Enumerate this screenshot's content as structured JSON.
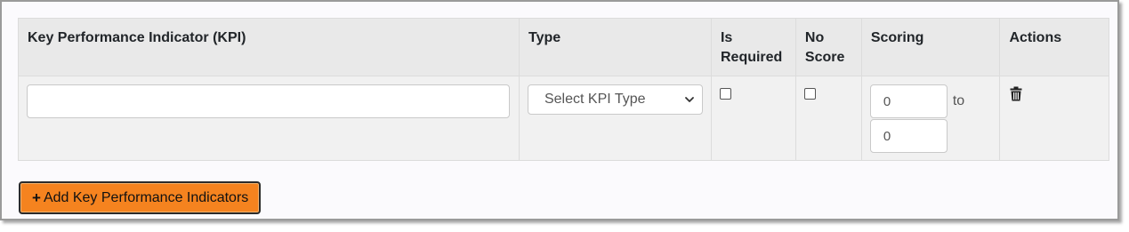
{
  "table": {
    "headers": {
      "kpi": "Key Performance Indicator (KPI)",
      "type": "Type",
      "is_required": "Is Required",
      "no_score": "No Score",
      "scoring": "Scoring",
      "actions": "Actions"
    },
    "rows": [
      {
        "kpi_value": "",
        "type_selected": "Select KPI Type",
        "is_required": false,
        "no_score": false,
        "score_from": "0",
        "score_to_label": "to",
        "score_to": "0"
      }
    ]
  },
  "add_button": {
    "icon": "plus-icon",
    "label": "Add Key Performance Indicators",
    "color": "#f5831f"
  },
  "icons": {
    "delete": "trash-icon",
    "select": "chevron-down-icon"
  }
}
